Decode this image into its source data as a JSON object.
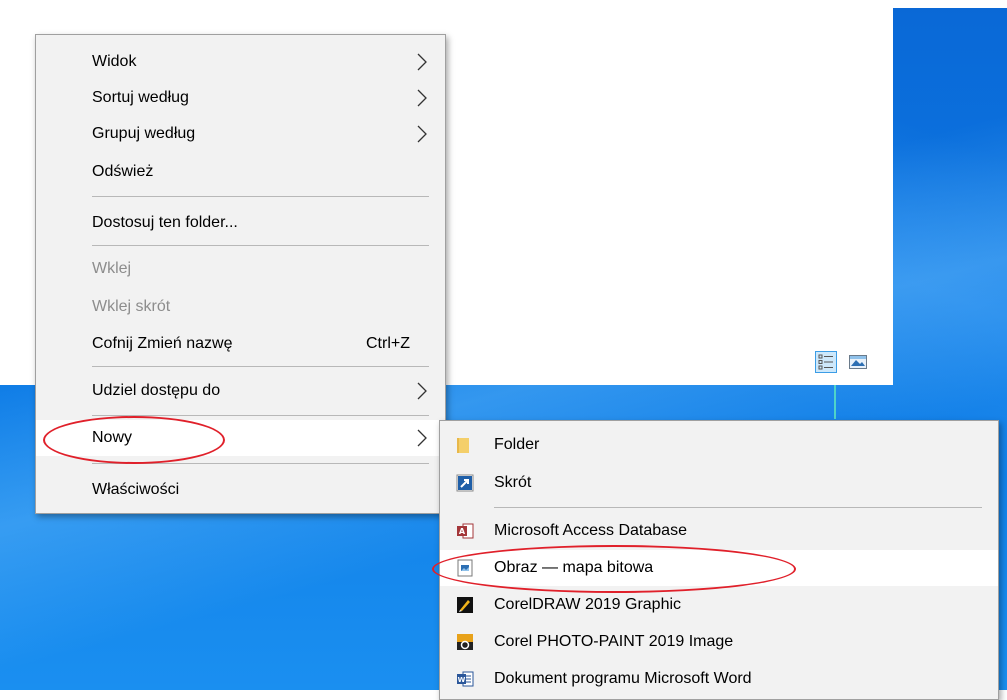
{
  "context_menu": {
    "items": [
      {
        "label": "Widok",
        "has_submenu": true
      },
      {
        "label": "Sortuj według",
        "has_submenu": true
      },
      {
        "label": "Grupuj według",
        "has_submenu": true
      },
      {
        "label": "Odśwież"
      },
      {
        "label": "Dostosuj ten folder..."
      },
      {
        "label": "Wklej",
        "disabled": true
      },
      {
        "label": "Wklej skrót",
        "disabled": true
      },
      {
        "label": "Cofnij Zmień nazwę",
        "shortcut": "Ctrl+Z"
      },
      {
        "label": "Udziel dostępu do",
        "has_submenu": true
      },
      {
        "label": "Nowy",
        "has_submenu": true,
        "highlighted": true
      },
      {
        "label": "Właściwości"
      }
    ]
  },
  "new_submenu": {
    "items": [
      {
        "label": "Folder",
        "icon": "folder-icon"
      },
      {
        "label": "Skrót",
        "icon": "shortcut-icon"
      },
      {
        "label": "Microsoft Access Database",
        "icon": "access-icon"
      },
      {
        "label": "Obraz — mapa bitowa",
        "icon": "bitmap-icon",
        "highlighted": true
      },
      {
        "label": "CorelDRAW 2019 Graphic",
        "icon": "coreldraw-icon"
      },
      {
        "label": "Corel PHOTO-PAINT 2019 Image",
        "icon": "photopaint-icon"
      },
      {
        "label": "Dokument programu Microsoft Word",
        "icon": "word-icon"
      }
    ]
  },
  "view_buttons": [
    {
      "icon": "details-view-icon",
      "active": true
    },
    {
      "icon": "large-icons-view-icon",
      "active": false
    }
  ],
  "colors": {
    "menu_bg": "#f2f2f2",
    "highlight_bg": "#ffffff",
    "annotation_red": "#e0202a",
    "desktop_blue": "#0c78e4",
    "disabled_text": "#8d8d8d"
  }
}
